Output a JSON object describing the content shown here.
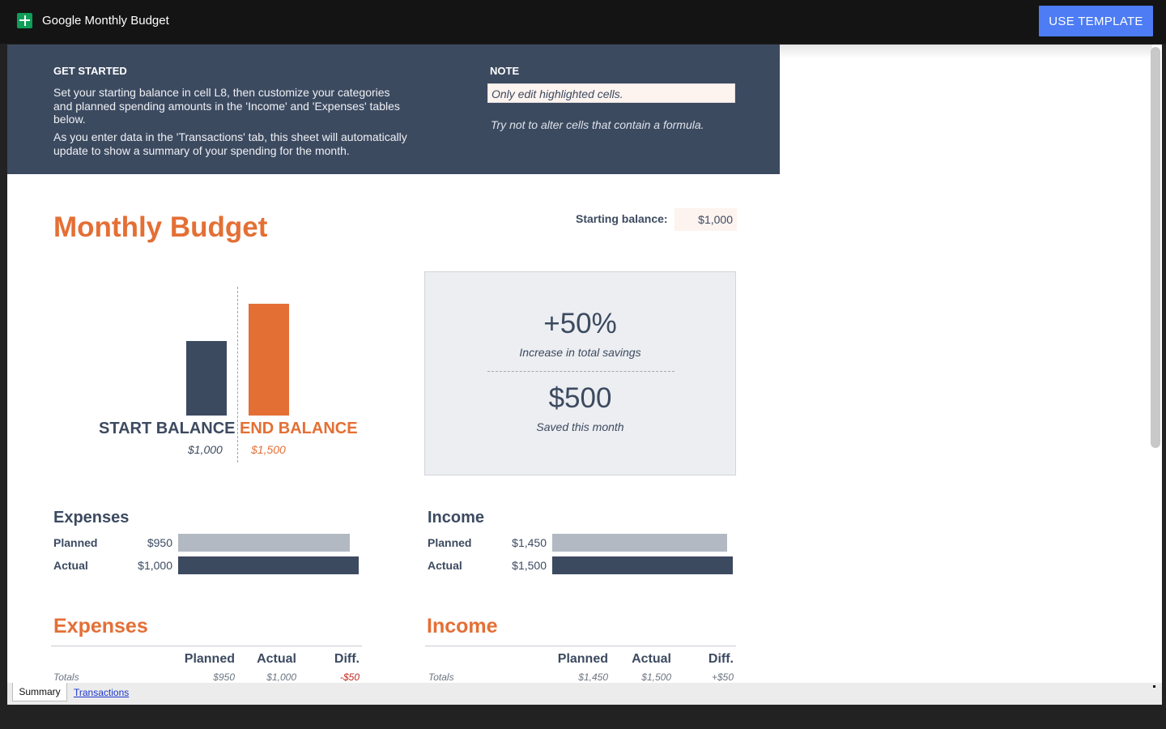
{
  "app": {
    "title": "Google Monthly Budget",
    "use_template": "USE TEMPLATE"
  },
  "banner": {
    "get_started_head": "GET STARTED",
    "line1": "Set your starting balance in cell L8, then customize your categories",
    "line2": "and planned spending amounts in the 'Income' and 'Expenses' tables",
    "line3": "below.",
    "line4": "As you enter data in the 'Transactions' tab, this sheet will automatically",
    "line5": "update to show a summary of your spending for the month.",
    "note_head": "NOTE",
    "note_highlight": "Only edit highlighted cells.",
    "note_text": "Try not to alter cells that contain a formula."
  },
  "summary": {
    "title": "Monthly Budget",
    "starting_balance_label": "Starting balance:",
    "starting_balance_value": "$1,000"
  },
  "balance_chart": {
    "start_label": "START BALANCE",
    "end_label": "END BALANCE",
    "start_value_text": "$1,000",
    "end_value_text": "$1,500",
    "start_value": 1000,
    "end_value": 1500,
    "start_color": "#3c4a60",
    "end_color": "#e46f35"
  },
  "savings": {
    "percent": "+50%",
    "percent_caption": "Increase in total savings",
    "amount": "$500",
    "amount_caption": "Saved this month"
  },
  "expenses_compare": {
    "heading": "Expenses",
    "planned_label": "Planned",
    "planned_text": "$950",
    "planned_value": 950,
    "actual_label": "Actual",
    "actual_text": "$1,000",
    "actual_value": 1000
  },
  "income_compare": {
    "heading": "Income",
    "planned_label": "Planned",
    "planned_text": "$1,450",
    "planned_value": 1450,
    "actual_label": "Actual",
    "actual_text": "$1,500",
    "actual_value": 1500
  },
  "compare_colors": {
    "planned": "#b3b9c2",
    "actual": "#3c4a60"
  },
  "expenses_table": {
    "title": "Expenses",
    "headers": [
      "Planned",
      "Actual",
      "Diff."
    ],
    "totals_label": "Totals",
    "totals": [
      "$950",
      "$1,000",
      "-$50"
    ]
  },
  "income_table": {
    "title": "Income",
    "headers": [
      "Planned",
      "Actual",
      "Diff."
    ],
    "totals_label": "Totals",
    "totals": [
      "$1,450",
      "$1,500",
      "+$50"
    ]
  },
  "tabs": {
    "active": "Summary",
    "other": "Transactions"
  }
}
